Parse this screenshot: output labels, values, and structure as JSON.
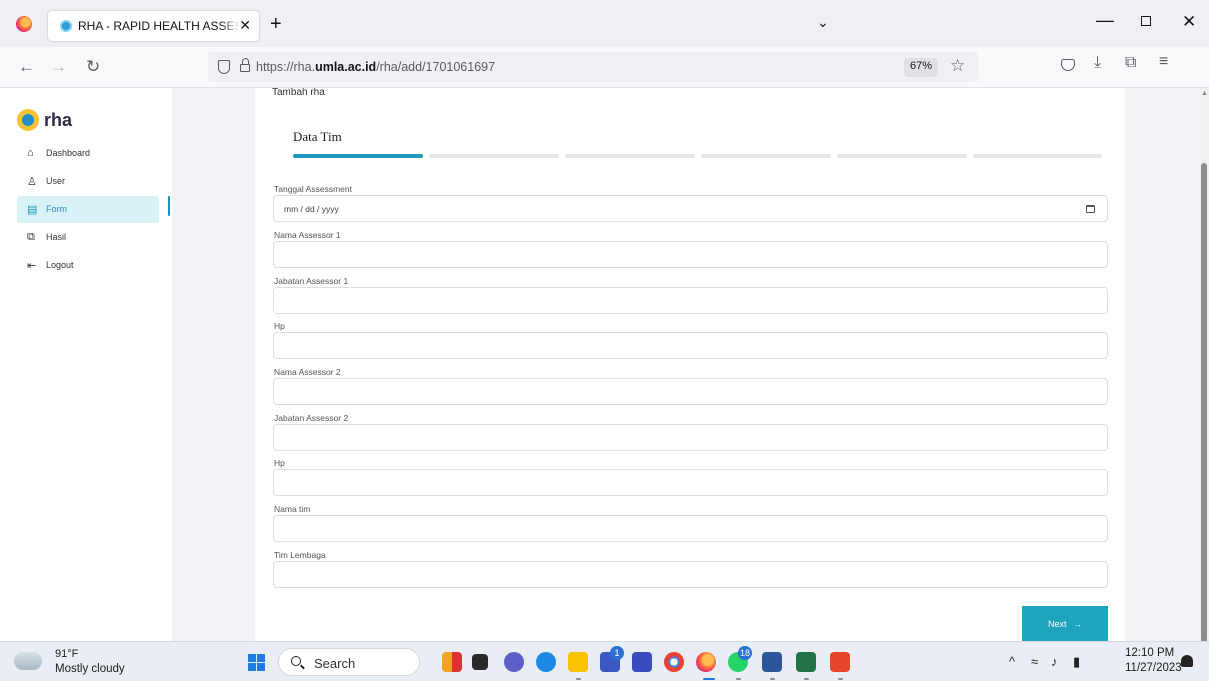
{
  "browser": {
    "tab_title": "RHA - RAPID HEALTH ASSESSMENT",
    "tab_close": "✕",
    "new_tab": "+",
    "url_prefix": "https://rha.",
    "url_domain": "umla.ac.id",
    "url_path": "/rha/add/1701061697",
    "zoom": "67%"
  },
  "sidebar": {
    "brand": "rha",
    "items": [
      {
        "label": "Dashboard",
        "icon": "home-icon",
        "glyph": "⌂"
      },
      {
        "label": "User",
        "icon": "user-icon",
        "glyph": "♙"
      },
      {
        "label": "Form",
        "icon": "form-icon",
        "glyph": "▤"
      },
      {
        "label": "Hasil",
        "icon": "copy-icon",
        "glyph": "⧉"
      },
      {
        "label": "Logout",
        "icon": "logout-icon",
        "glyph": "⇤"
      }
    ],
    "active": "Form"
  },
  "main": {
    "heading": "Tambah rha",
    "step_title": "Data Tim",
    "steps_total": 6,
    "current_step": 1,
    "fields": [
      {
        "label": "Tanggal Assessment",
        "value": "",
        "placeholder": "mm / dd / yyyy",
        "type": "date"
      },
      {
        "label": "Nama Assessor 1",
        "value": ""
      },
      {
        "label": "Jabatan Assessor 1",
        "value": ""
      },
      {
        "label": "Hp",
        "value": ""
      },
      {
        "label": "Nama Assessor 2",
        "value": ""
      },
      {
        "label": "Jabatan Assessor 2",
        "value": ""
      },
      {
        "label": "Hp",
        "value": ""
      },
      {
        "label": "Nama tim",
        "value": ""
      },
      {
        "label": "Tim Lembaga",
        "value": ""
      }
    ],
    "next_label": "Next",
    "next_arrow": "→"
  },
  "taskbar": {
    "weather_temp": "91°F",
    "weather_desc": "Mostly cloudy",
    "search_label": "Search",
    "time": "12:10 PM",
    "date": "11/27/2023",
    "badges": {
      "teams": "1",
      "whatsapp": "18"
    }
  },
  "colors": {
    "accent": "#1ea4bd",
    "sidebar_active_bg": "#d9f2f8"
  }
}
